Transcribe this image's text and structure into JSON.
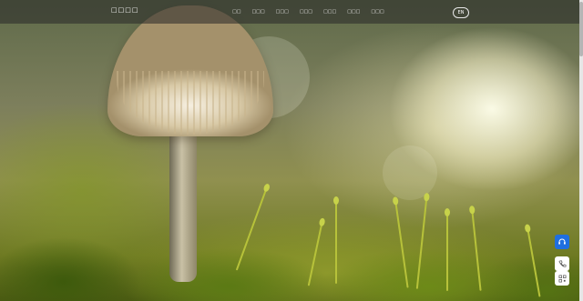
{
  "header": {
    "logo_text": "□□□□",
    "nav_items": [
      "□□",
      "□□□",
      "□□□",
      "□□□",
      "□□□",
      "□□□",
      "□□□"
    ],
    "language_button": "EN"
  },
  "floating_toolbar": {
    "service_icon": "headset-icon",
    "phone_icon": "phone-icon",
    "qr_icon": "qr-code-icon"
  },
  "hero": {
    "image_subject": "mushroom-on-moss"
  },
  "colors": {
    "accent": "#1f6fe0",
    "nav_bg": "rgba(40,40,40,0.55)"
  },
  "watermark_text": ""
}
